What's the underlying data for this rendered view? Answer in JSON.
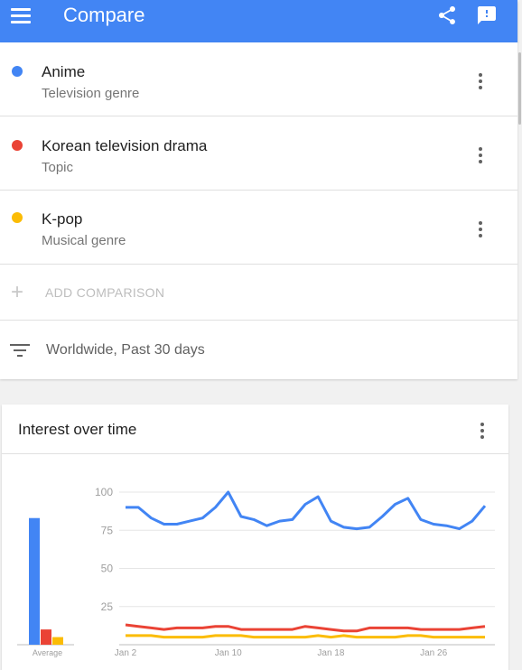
{
  "appbar": {
    "title": "Compare"
  },
  "terms": [
    {
      "name": "Anime",
      "type": "Television genre",
      "color": "#4285f4"
    },
    {
      "name": "Korean television drama",
      "type": "Topic",
      "color": "#ea4335"
    },
    {
      "name": "K-pop",
      "type": "Musical genre",
      "color": "#fbbc05"
    }
  ],
  "add_comparison": {
    "label": "ADD COMPARISON"
  },
  "filter": {
    "label": "Worldwide, Past 30 days"
  },
  "card": {
    "title": "Interest over time"
  },
  "chart_data": {
    "type": "line",
    "ylim": [
      0,
      100
    ],
    "y_ticks": [
      "100",
      "75",
      "50",
      "25"
    ],
    "x_ticks": [
      "Jan 2",
      "Jan 10",
      "Jan 18",
      "Jan 26"
    ],
    "x": [
      "Jan 1",
      "Jan 2",
      "Jan 3",
      "Jan 4",
      "Jan 5",
      "Jan 6",
      "Jan 7",
      "Jan 8",
      "Jan 9",
      "Jan 10",
      "Jan 11",
      "Jan 12",
      "Jan 13",
      "Jan 14",
      "Jan 15",
      "Jan 16",
      "Jan 17",
      "Jan 18",
      "Jan 19",
      "Jan 20",
      "Jan 21",
      "Jan 22",
      "Jan 23",
      "Jan 24",
      "Jan 25",
      "Jan 26",
      "Jan 27",
      "Jan 28",
      "Jan 29",
      "Jan 30",
      "Jan 31"
    ],
    "series": [
      {
        "color": "#4285f4",
        "values": [
          90,
          90,
          83,
          79,
          79,
          81,
          83,
          90,
          100,
          84,
          82,
          78,
          81,
          82,
          92,
          97,
          81,
          77,
          76,
          77,
          84,
          92,
          96,
          82,
          79,
          78,
          76,
          81,
          91
        ]
      },
      {
        "color": "#ea4335",
        "values": [
          13,
          12,
          11,
          10,
          11,
          11,
          11,
          12,
          12,
          10,
          10,
          10,
          10,
          10,
          12,
          11,
          10,
          9,
          9,
          11,
          11,
          11,
          11,
          10,
          10,
          10,
          10,
          11,
          12
        ]
      },
      {
        "color": "#fbbc05",
        "values": [
          6,
          6,
          6,
          5,
          5,
          5,
          5,
          6,
          6,
          6,
          5,
          5,
          5,
          5,
          5,
          6,
          5,
          6,
          5,
          5,
          5,
          5,
          6,
          6,
          5,
          5,
          5,
          5,
          5
        ]
      }
    ],
    "average": {
      "label": "Average",
      "values": [
        83,
        10,
        5
      ]
    }
  }
}
